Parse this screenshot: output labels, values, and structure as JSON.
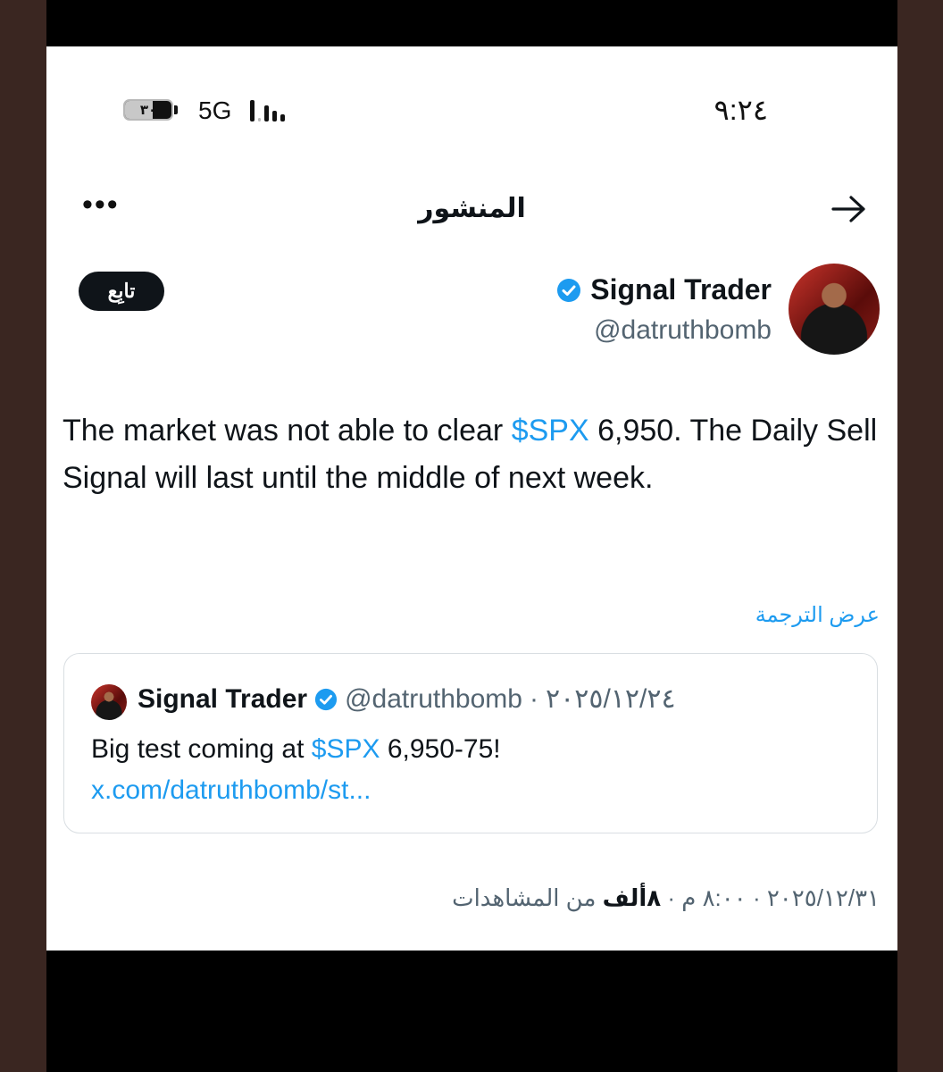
{
  "status_bar": {
    "battery": "٣٠",
    "network": "5G",
    "time": "٩:٢٤"
  },
  "header": {
    "title": "المنشور",
    "back_icon": "arrow-right-icon",
    "more_icon": "more-horizontal-icon"
  },
  "author": {
    "name": "Signal Trader",
    "handle": "@datruthbomb",
    "follow_label": "تابِع"
  },
  "tweet": {
    "text_part1": "The market was not able to clear ",
    "cashtag": "$SPX",
    "text_part2": " 6,950. The Daily Sell Signal will last until the middle of next week.",
    "translate_label": "عرض الترجمة"
  },
  "quote": {
    "name": "Signal Trader",
    "handle": "@datruthbomb",
    "separator": "·",
    "date": "٢٠٢٥/١٢/٢٤",
    "text_part1": "Big test coming at ",
    "cashtag": "$SPX",
    "text_part2": " 6,950-75! ",
    "link": "x.com/datruthbomb/st..."
  },
  "meta": {
    "date": "٢٠٢٥/١٢/٣١",
    "time": "٨:٠٠ م",
    "views_count": "٨ألف",
    "views_label": "من المشاهدات",
    "separator": " · "
  },
  "colors": {
    "accent": "#1d9bf0",
    "text": "#0f1419",
    "secondary": "#536471"
  }
}
